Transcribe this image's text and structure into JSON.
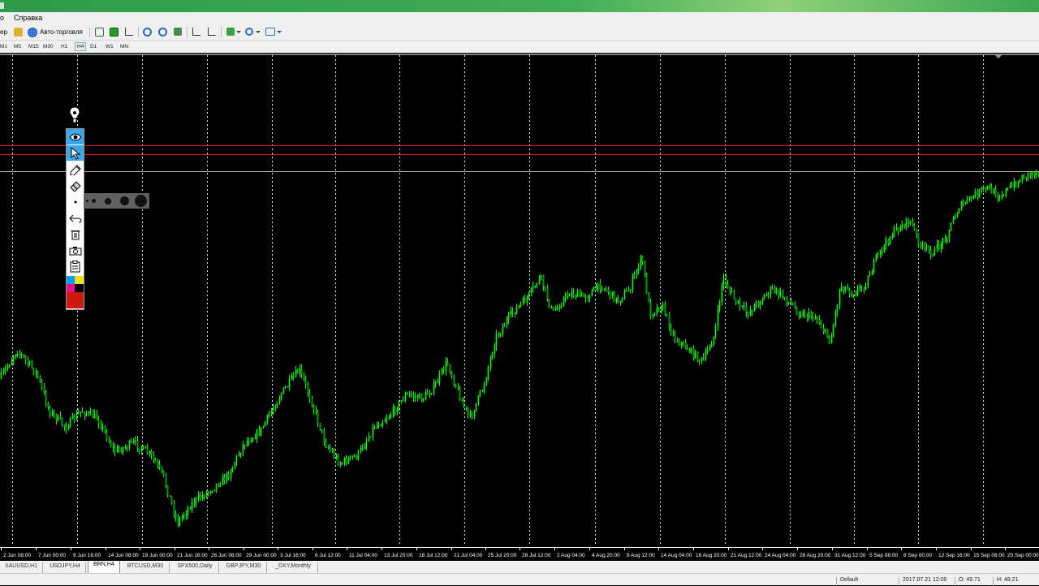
{
  "menu": {
    "left_fragment": "о",
    "help": "Справка"
  },
  "toolbar": {
    "left_fragment": "ер",
    "autotrading": "Авто-торговля"
  },
  "timeframes": [
    "M1",
    "M5",
    "M15",
    "M30",
    "H1",
    "H4",
    "D1",
    "W1",
    "MN"
  ],
  "active_timeframe": "H4",
  "chart": {
    "background": "#000000",
    "candle_color": "#00ff00",
    "grid_color": "#ffffff",
    "level_color": "#e02020",
    "x_tick_labels": [
      "2 Jun 08:00",
      "7 Jun 00:00",
      "9 Jun 16:00",
      "14 Jun 08:00",
      "19 Jun 00:00",
      "21 Jun 16:00",
      "26 Jun 08:00",
      "29 Jun 00:00",
      "3 Jul 16:00",
      "6 Jul 12:00",
      "11 Jul 04:00",
      "13 Jul 20:00",
      "18 Jul 12:00",
      "21 Jul 04:00",
      "25 Jul 20:00",
      "28 Jul 12:00",
      "2 Aug 04:00",
      "4 Aug 20:00",
      "9 Aug 12:00",
      "14 Aug 04:00",
      "16 Aug 20:00",
      "21 Aug 12:00",
      "24 Aug 04:00",
      "28 Aug 20:00",
      "31 Aug 12:00",
      "5 Sep 08:00",
      "8 Sep 00:00",
      "12 Sep 16:00",
      "15 Sep 08:00",
      "20 Sep 00:00"
    ]
  },
  "palette": {
    "tools": [
      "pen-marker-icon",
      "eye-icon",
      "cursor-arrow-icon",
      "pencil-icon",
      "eraser-icon",
      "undo-icon",
      "trash-icon",
      "camera-icon",
      "clipboard-icon"
    ],
    "colors": [
      "#00a0e8",
      "#f0e020",
      "#e0108a",
      "#000000"
    ],
    "current_color": "#cc1a10",
    "brush_sizes": [
      1,
      2,
      3,
      4,
      5
    ]
  },
  "tabs": [
    "XAUUSD,H1",
    "USDJPY,H4",
    "BRN,H4",
    "BTCUSD,M30",
    "SPX500,Daily",
    "GBPJPY,M30",
    "_DXY,Monthly"
  ],
  "active_tab": "BRN,H4",
  "status": {
    "profile": "Default",
    "datetime": "2017.07.21 12:00",
    "open": "O: 49.71",
    "high": "H: 48.21"
  }
}
